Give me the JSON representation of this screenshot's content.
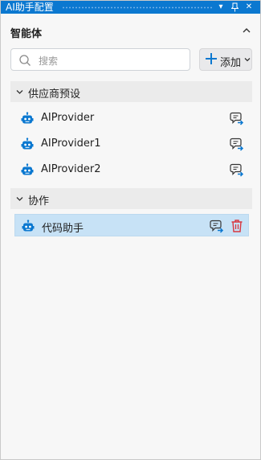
{
  "window": {
    "title": "AI助手配置"
  },
  "panel": {
    "title": "智能体"
  },
  "search": {
    "placeholder": "搜索"
  },
  "toolbar": {
    "add_label": "添加"
  },
  "groups": [
    {
      "label": "供应商预设",
      "items": [
        {
          "label": "AIProvider"
        },
        {
          "label": "AIProvider1"
        },
        {
          "label": "AIProvider2"
        }
      ]
    },
    {
      "label": "协作",
      "items": [
        {
          "label": "代码助手",
          "selected": true
        }
      ]
    }
  ],
  "colors": {
    "accent": "#0b78d0",
    "delete": "#d9363e",
    "selection": "#c7e2f6"
  }
}
